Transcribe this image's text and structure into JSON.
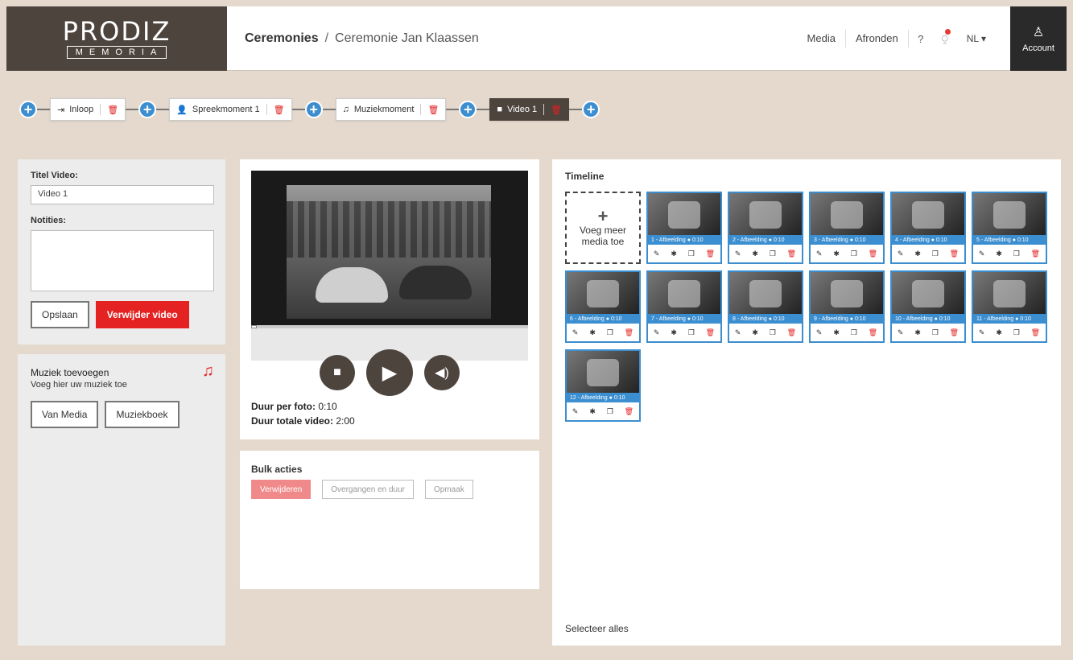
{
  "header": {
    "logo_main": "PRODIZ",
    "logo_sub": "MEMORIA",
    "breadcrumb_root": "Ceremonies",
    "breadcrumb_sep": "/",
    "breadcrumb_current": "Ceremonie Jan Klaassen",
    "nav_media": "Media",
    "nav_finish": "Afronden",
    "help_icon": "?",
    "notif_icon": "⍜",
    "lang": "NL ▾",
    "account_label": "Account",
    "account_icon": "♙"
  },
  "moments": [
    {
      "icon": "⇥",
      "label": "Inloop"
    },
    {
      "icon": "👤",
      "label": "Spreekmoment 1"
    },
    {
      "icon": "♫",
      "label": "Muziekmoment"
    },
    {
      "icon": "■",
      "label": "Video 1"
    }
  ],
  "video_form": {
    "title_label": "Titel Video:",
    "title_value": "Video 1",
    "notes_label": "Notities:",
    "save": "Opslaan",
    "delete": "Verwijder video"
  },
  "music": {
    "title": "Muziek toevoegen",
    "subtitle": "Voeg hier uw muziek toe",
    "from_media": "Van Media",
    "music_book": "Muziekboek",
    "note_icon": "♫"
  },
  "player": {
    "progress": 0.02,
    "stop_icon": "■",
    "play_icon": "▶",
    "volume_icon": "◀)",
    "per_photo_label": "Duur per foto:",
    "per_photo_value": "0:10",
    "total_label": "Duur totale video:",
    "total_value": "2:00"
  },
  "bulk": {
    "title": "Bulk acties",
    "delete": "Verwijderen",
    "transitions": "Overgangen en duur",
    "layout": "Opmaak"
  },
  "timeline": {
    "title": "Timeline",
    "add_label": "Voeg meer media toe",
    "add_icon": "+",
    "select_all": "Selecteer alles",
    "items": [
      {
        "label": "1 - Afbeelding",
        "duration": "0:10"
      },
      {
        "label": "2 - Afbeelding",
        "duration": "0:10"
      },
      {
        "label": "3 - Afbeelding",
        "duration": "0:10"
      },
      {
        "label": "4 - Afbeelding",
        "duration": "0:10"
      },
      {
        "label": "5 - Afbeelding",
        "duration": "0:10"
      },
      {
        "label": "6 - Afbeelding",
        "duration": "0:10"
      },
      {
        "label": "7 - Afbeelding",
        "duration": "0:10"
      },
      {
        "label": "8 - Afbeelding",
        "duration": "0:10"
      },
      {
        "label": "9 - Afbeelding",
        "duration": "0:10"
      },
      {
        "label": "10 - Afbeelding",
        "duration": "0:10"
      },
      {
        "label": "11 - Afbeelding",
        "duration": "0:10"
      },
      {
        "label": "12 - Afbeelding",
        "duration": "0:10"
      }
    ]
  },
  "colors": {
    "brand_dark": "#4e443e",
    "accent_blue": "#3b8ed0",
    "danger_red": "#e52222",
    "background": "#e4d9cc"
  }
}
